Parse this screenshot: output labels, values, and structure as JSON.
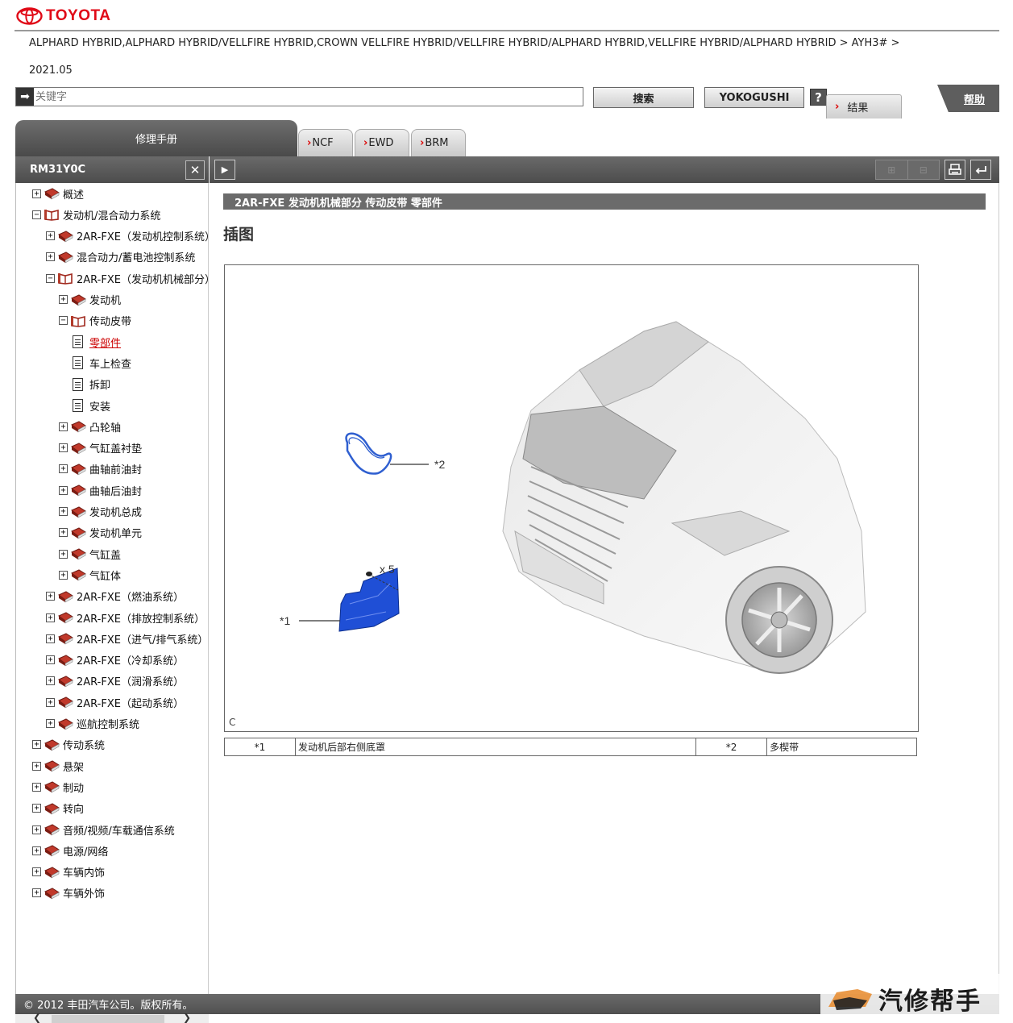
{
  "brand": {
    "name": "TOYOTA",
    "color": "#e00a17"
  },
  "breadcrumb": {
    "path": "ALPHARD HYBRID,ALPHARD HYBRID/VELLFIRE HYBRID,CROWN VELLFIRE HYBRID/VELLFIRE HYBRID/ALPHARD HYBRID,VELLFIRE HYBRID/ALPHARD HYBRID > AYH3# >",
    "date": "2021.05"
  },
  "search": {
    "placeholder": "关键字",
    "search_label": "搜索",
    "yokogushi_label": "YOKOGUSHI",
    "question_label": "?"
  },
  "results_tab": {
    "label": "结果"
  },
  "help": {
    "label": "帮助"
  },
  "tabs": [
    {
      "label": "修理手册",
      "active": true
    },
    {
      "label": "NCF"
    },
    {
      "label": "EWD"
    },
    {
      "label": "BRM"
    }
  ],
  "left_header": {
    "title": "RM31Y0C",
    "close_label": "✕"
  },
  "tree": [
    {
      "label": "概述",
      "toggle": "+",
      "icon": "book-closed",
      "level": 1
    },
    {
      "label": "发动机/混合动力系统",
      "toggle": "-",
      "icon": "book-open",
      "level": 1
    },
    {
      "label": "2AR-FXE（发动机控制系统）",
      "toggle": "+",
      "icon": "book-closed",
      "level": 2
    },
    {
      "label": "混合动力/蓄电池控制系统",
      "toggle": "+",
      "icon": "book-closed",
      "level": 2
    },
    {
      "label": "2AR-FXE（发动机机械部分）",
      "toggle": "-",
      "icon": "book-open",
      "level": 2
    },
    {
      "label": "发动机",
      "toggle": "+",
      "icon": "book-closed",
      "level": 3
    },
    {
      "label": "传动皮带",
      "toggle": "-",
      "icon": "book-open",
      "level": 3
    },
    {
      "label": "零部件",
      "toggle": "",
      "icon": "document",
      "level": 4,
      "selected": true
    },
    {
      "label": "车上检查",
      "toggle": "",
      "icon": "document",
      "level": 4
    },
    {
      "label": "拆卸",
      "toggle": "",
      "icon": "document",
      "level": 4
    },
    {
      "label": "安装",
      "toggle": "",
      "icon": "document",
      "level": 4
    },
    {
      "label": "凸轮轴",
      "toggle": "+",
      "icon": "book-closed",
      "level": 3
    },
    {
      "label": "气缸盖衬垫",
      "toggle": "+",
      "icon": "book-closed",
      "level": 3
    },
    {
      "label": "曲轴前油封",
      "toggle": "+",
      "icon": "book-closed",
      "level": 3
    },
    {
      "label": "曲轴后油封",
      "toggle": "+",
      "icon": "book-closed",
      "level": 3
    },
    {
      "label": "发动机总成",
      "toggle": "+",
      "icon": "book-closed",
      "level": 3
    },
    {
      "label": "发动机单元",
      "toggle": "+",
      "icon": "book-closed",
      "level": 3
    },
    {
      "label": "气缸盖",
      "toggle": "+",
      "icon": "book-closed",
      "level": 3
    },
    {
      "label": "气缸体",
      "toggle": "+",
      "icon": "book-closed",
      "level": 3
    },
    {
      "label": "2AR-FXE（燃油系统）",
      "toggle": "+",
      "icon": "book-closed",
      "level": 2
    },
    {
      "label": "2AR-FXE（排放控制系统）",
      "toggle": "+",
      "icon": "book-closed",
      "level": 2
    },
    {
      "label": "2AR-FXE（进气/排气系统）",
      "toggle": "+",
      "icon": "book-closed",
      "level": 2
    },
    {
      "label": "2AR-FXE（冷却系统）",
      "toggle": "+",
      "icon": "book-closed",
      "level": 2
    },
    {
      "label": "2AR-FXE（润滑系统）",
      "toggle": "+",
      "icon": "book-closed",
      "level": 2
    },
    {
      "label": "2AR-FXE（起动系统）",
      "toggle": "+",
      "icon": "book-closed",
      "level": 2
    },
    {
      "label": "巡航控制系统",
      "toggle": "+",
      "icon": "book-closed",
      "level": 2
    },
    {
      "label": "传动系统",
      "toggle": "+",
      "icon": "book-closed",
      "level": 1
    },
    {
      "label": "悬架",
      "toggle": "+",
      "icon": "book-closed",
      "level": 1
    },
    {
      "label": "制动",
      "toggle": "+",
      "icon": "book-closed",
      "level": 1
    },
    {
      "label": "转向",
      "toggle": "+",
      "icon": "book-closed",
      "level": 1
    },
    {
      "label": "音频/视频/车载通信系统",
      "toggle": "+",
      "icon": "book-closed",
      "level": 1
    },
    {
      "label": "电源/网络",
      "toggle": "+",
      "icon": "book-closed",
      "level": 1
    },
    {
      "label": "车辆内饰",
      "toggle": "+",
      "icon": "book-closed",
      "level": 1
    },
    {
      "label": "车辆外饰",
      "toggle": "+",
      "icon": "book-closed",
      "level": 1
    }
  ],
  "content": {
    "title_bar": "2AR-FXE 发动机机械部分  传动皮带  零部件",
    "heading": "插图",
    "figure": {
      "callout_1": "*1",
      "callout_2": "*2",
      "qty": "x 5",
      "letter": "C"
    },
    "legend": [
      {
        "num": "*1",
        "name": "发动机后部右侧底罩",
        "num2": "*2",
        "name2": "多楔带"
      }
    ]
  },
  "footer": {
    "copyright": "© 2012 丰田汽车公司。版权所有。"
  },
  "watermark": {
    "text": "汽修帮手"
  },
  "colors": {
    "header_gray": "#555555",
    "part_blue": "#1f4fd6",
    "link_red": "#cc0000"
  }
}
